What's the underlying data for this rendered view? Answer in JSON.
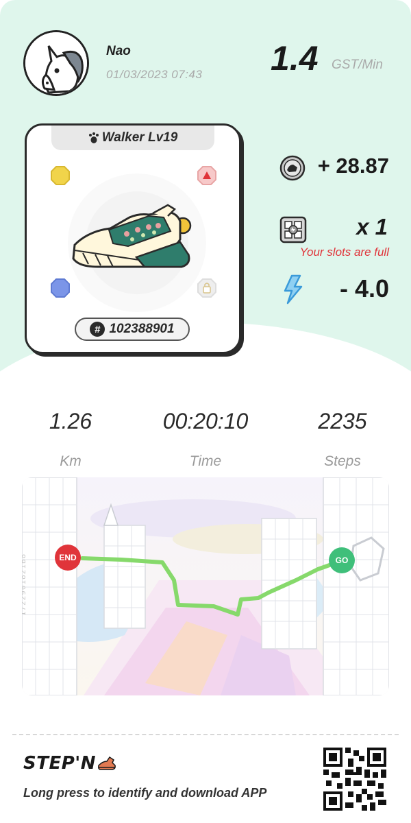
{
  "user": {
    "name": "Nao",
    "datetime": "01/03/2023 07:43"
  },
  "rate": {
    "value": "1.4",
    "unit": "GST/Min"
  },
  "sneaker": {
    "level_label": "Walker Lv19",
    "id": "102388901",
    "sockets": [
      "yellow",
      "red",
      "blue",
      "locked"
    ]
  },
  "rewards": {
    "gst": "+ 28.87",
    "mystery_box": "x 1",
    "slots_message": "Your slots are full",
    "energy": "- 4.0"
  },
  "stats": [
    {
      "value": "1.26",
      "label": "Km"
    },
    {
      "value": "00:20:10",
      "label": "Time"
    },
    {
      "value": "2235",
      "label": "Steps"
    }
  ],
  "map": {
    "end_label": "END",
    "go_label": "GO",
    "watermark": "1722901821B8"
  },
  "footer": {
    "logo_text": "STEP'N",
    "tagline": "Long press to identify and download APP"
  },
  "colors": {
    "top_background": "#dff6ec",
    "route": "#86d96b",
    "end_marker": "#e0343a",
    "go_marker": "#3fbf7a",
    "warning_text": "#e0343a",
    "energy": "#3a9ad9"
  },
  "icons": [
    "unicorn-avatar-icon",
    "paw-icon",
    "gst-coin-icon",
    "mystery-box-icon",
    "energy-bolt-icon",
    "qr-code-icon"
  ]
}
